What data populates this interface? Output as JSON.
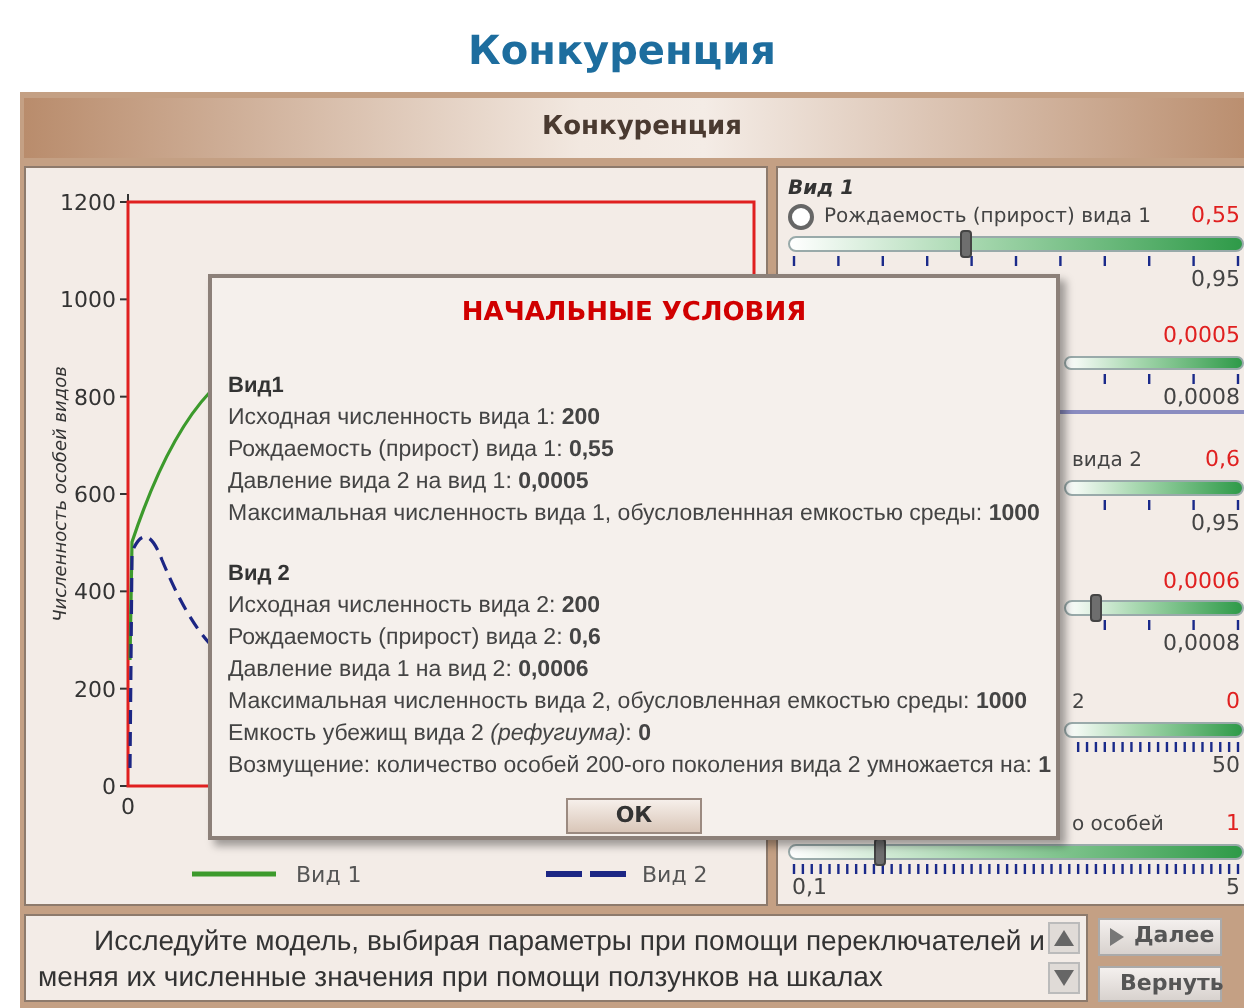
{
  "page_title": "Конкуренция",
  "window": {
    "title": "Конкуренция"
  },
  "chart": {
    "y_axis": {
      "title": "Численность особей видов",
      "ticks": [
        "1200",
        "1000",
        "800",
        "600",
        "400",
        "200",
        "0"
      ]
    },
    "x_axis": {
      "ticks": [
        "0"
      ]
    },
    "legend": [
      {
        "label": "Вид 1",
        "color": "#3c9a2c",
        "kind": "solid"
      },
      {
        "label": "Вид 2",
        "color": "#1c2684",
        "kind": "dashed"
      }
    ]
  },
  "controls": [
    {
      "group": "Вид 1",
      "kind": "radio",
      "checked": false,
      "label": "Рождаемость (прирост) вида 1",
      "value": "0,55",
      "level": 0.39,
      "max": "0,95"
    },
    {
      "kind": "sparse",
      "value": "0,0005",
      "max": "0,0008"
    },
    {
      "kind": "sparse",
      "label": "вида 2",
      "value": "0,6",
      "max": "0,95"
    },
    {
      "kind": "sparse",
      "value": "0,0006",
      "level": 0.17,
      "max": "0,0008"
    },
    {
      "kind": "dense",
      "label": "2",
      "value": "0",
      "max": "50"
    },
    {
      "kind": "dense",
      "label": "о особей",
      "value": "1",
      "level": 0.2,
      "min": "0,1",
      "max": "5"
    }
  ],
  "dialog": {
    "title": "НАЧАЛЬНЫЕ УСЛОВИЯ",
    "sections": [
      {
        "heading": "Вид1",
        "lines": [
          "Исходная численность вида 1: **200**",
          "Рождаемость (прирост) вида 1: **0,55**",
          "Давление вида 2  на вид 1: **0,0005**",
          "Максимальная численность вида 1, обусловленнная емкостью среды: **1000**"
        ]
      },
      {
        "heading": "Вид 2",
        "lines": [
          "Исходная численность вида 2: **200**",
          "Рождаемость (прирост) вида 2: **0,6**",
          "Давление вида 1 на вид 2: **0,0006**",
          "Максимальная численность вида 2, обусловленная емкостью среды: **1000**",
          "Емкость убежищ вида 2 *(рефугиума)*:  **0**",
          "Возмущение: количество особей 200-ого поколения вида 2 умножается на: **1**"
        ]
      }
    ],
    "button": "ОК"
  },
  "instructions": "Исследуйте модель, выбирая параметры при помощи переключателей и меняя их численные значения при помощи ползунков на шкалах",
  "nav_buttons": [
    {
      "label": "Далее",
      "kind": "next"
    },
    {
      "label": "Вернуть",
      "kind": "back"
    }
  ]
}
